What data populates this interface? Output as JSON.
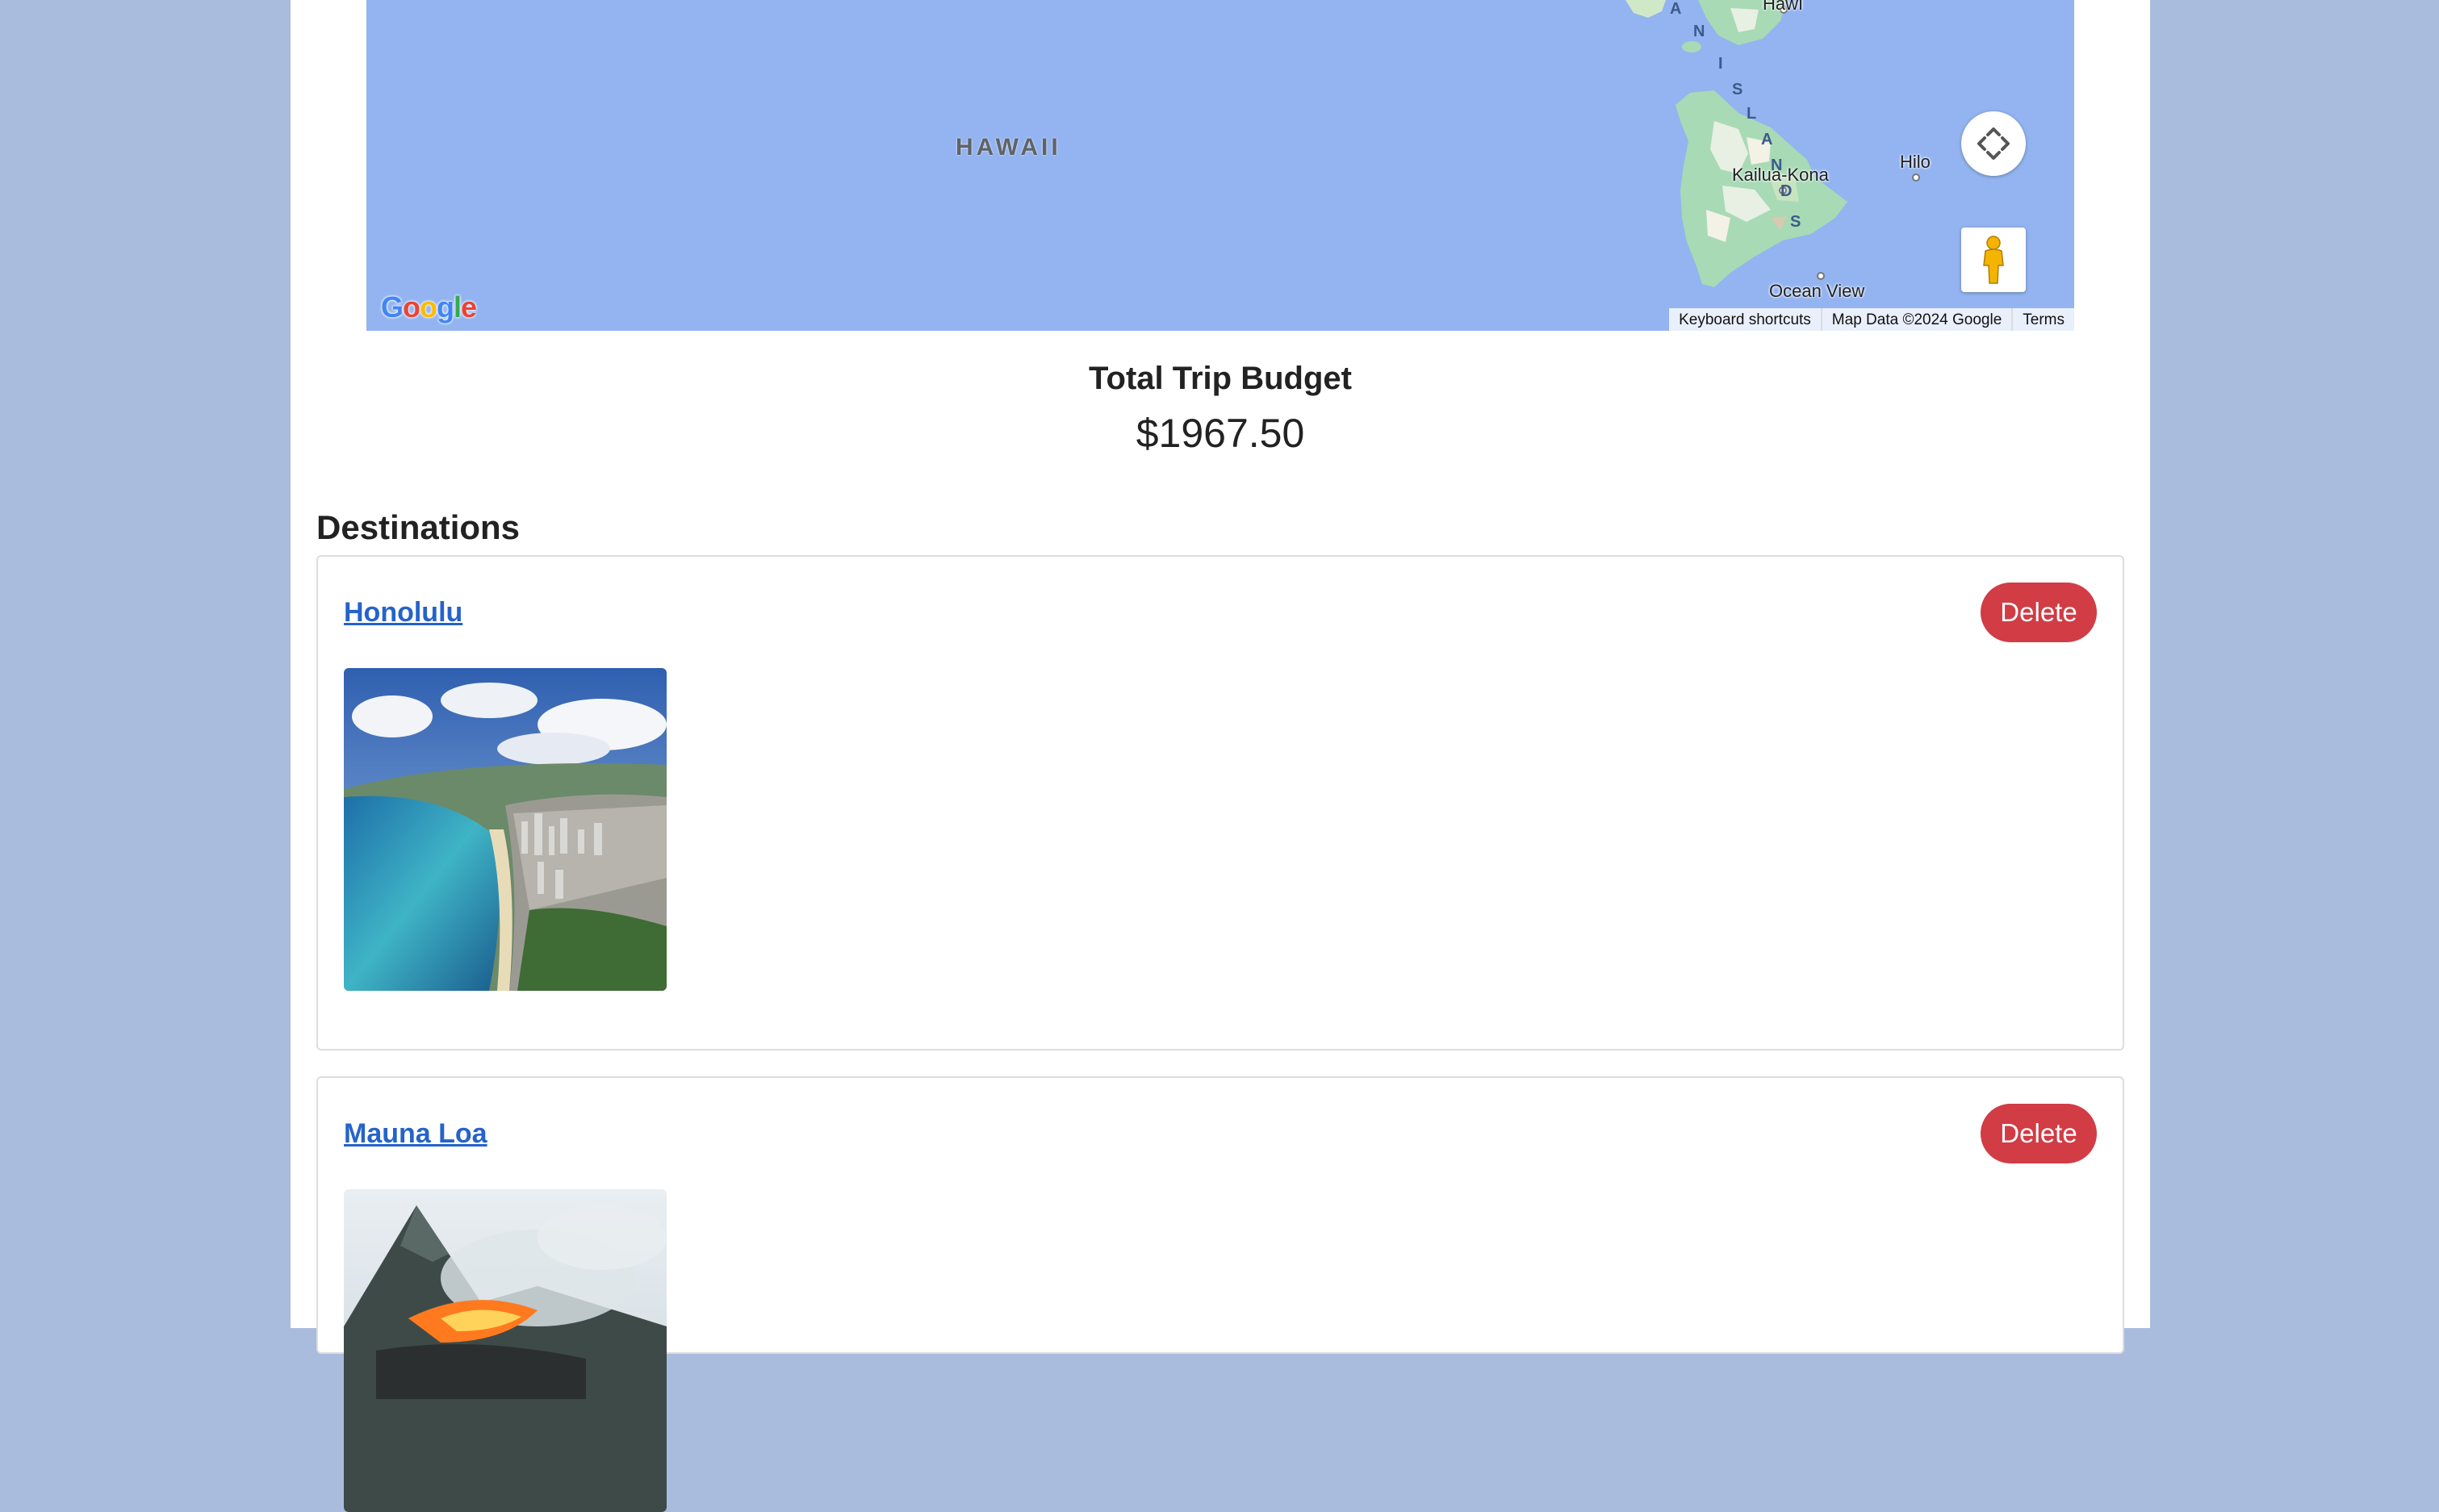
{
  "map": {
    "region_label": "HAWAII",
    "island_arc_letters": [
      "A",
      "N",
      "I",
      "S",
      "L",
      "A",
      "N",
      "D",
      "S"
    ],
    "cities": {
      "hawi": "Hāwī",
      "kailua_kona": "Kailua-Kona",
      "hilo": "Hilo",
      "ocean_view": "Ocean View"
    },
    "logo_text": "Google",
    "attribution": {
      "keyboard": "Keyboard shortcuts",
      "map_data": "Map Data ©2024 Google",
      "terms": "Terms"
    },
    "colors": {
      "ocean": "#93b4f0",
      "land": "#a8dab5"
    }
  },
  "budget": {
    "title": "Total Trip Budget",
    "amount": "$1967.50"
  },
  "destinations": {
    "heading": "Destinations",
    "items": [
      {
        "name": "Honolulu",
        "delete_label": "Delete"
      },
      {
        "name": "Mauna Loa",
        "delete_label": "Delete"
      }
    ]
  },
  "colors": {
    "page_bg": "#aabcde",
    "link": "#2563c9",
    "delete": "#d13c45"
  }
}
